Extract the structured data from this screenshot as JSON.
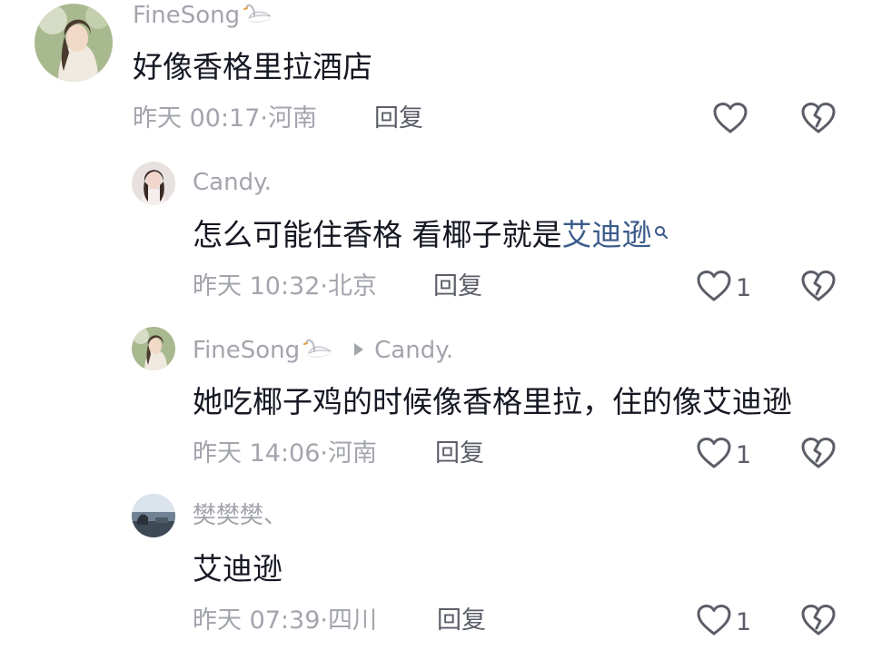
{
  "comments": [
    {
      "username": "FineSong",
      "text": "好像香格里拉酒店",
      "time": "昨天 00:17",
      "location": "河南",
      "reply_label": "回复",
      "likes": ""
    },
    {
      "username": "Candy.",
      "text": "怎么可能住香格 看椰子就是",
      "link_text": "艾迪逊",
      "time": "昨天 10:32",
      "location": "北京",
      "reply_label": "回复",
      "likes": "1"
    },
    {
      "username": "FineSong",
      "reply_to": "Candy.",
      "text": "她吃椰子鸡的时候像香格里拉，住的像艾迪逊",
      "time": "昨天 14:06",
      "location": "河南",
      "reply_label": "回复",
      "likes": "1"
    },
    {
      "username": "樊樊樊、",
      "text": "艾迪逊",
      "time": "昨天 07:39",
      "location": "四川",
      "reply_label": "回复",
      "likes": "1"
    }
  ],
  "colors": {
    "text": "#161823",
    "muted": "#a3a5ad",
    "action": "#5b5e68",
    "link": "#3c5b8a"
  },
  "icons": [
    "swan-icon",
    "reply-arrow-icon",
    "search-icon",
    "heart-icon",
    "broken-heart-icon"
  ]
}
